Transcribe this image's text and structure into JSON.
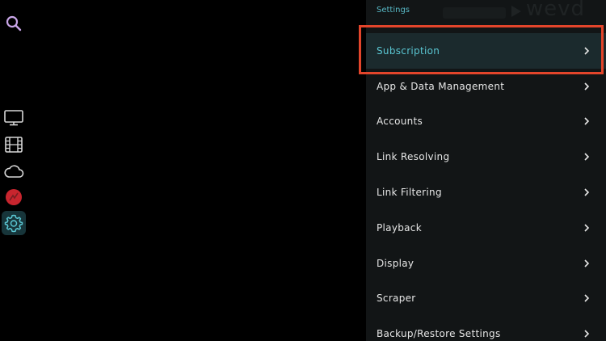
{
  "panel": {
    "title": "Settings",
    "watermark": "wevd"
  },
  "menu": {
    "items": [
      {
        "label": "Subscription",
        "selected": true
      },
      {
        "label": "App & Data Management"
      },
      {
        "label": "Accounts"
      },
      {
        "label": "Link Resolving"
      },
      {
        "label": "Link Filtering"
      },
      {
        "label": "Playback"
      },
      {
        "label": "Display"
      },
      {
        "label": "Scraper"
      },
      {
        "label": "Backup/Restore Settings"
      }
    ]
  },
  "rail": {
    "icons": [
      "search-icon",
      "tv-icon",
      "film-icon",
      "cloud-icon",
      "real-debrid-icon",
      "gear-icon"
    ],
    "active": "gear-icon"
  },
  "colors": {
    "accent": "#5ac6d2",
    "highlight": "#e3452b",
    "panel_bg": "#121516",
    "selected_bg": "#1b2a2d"
  }
}
